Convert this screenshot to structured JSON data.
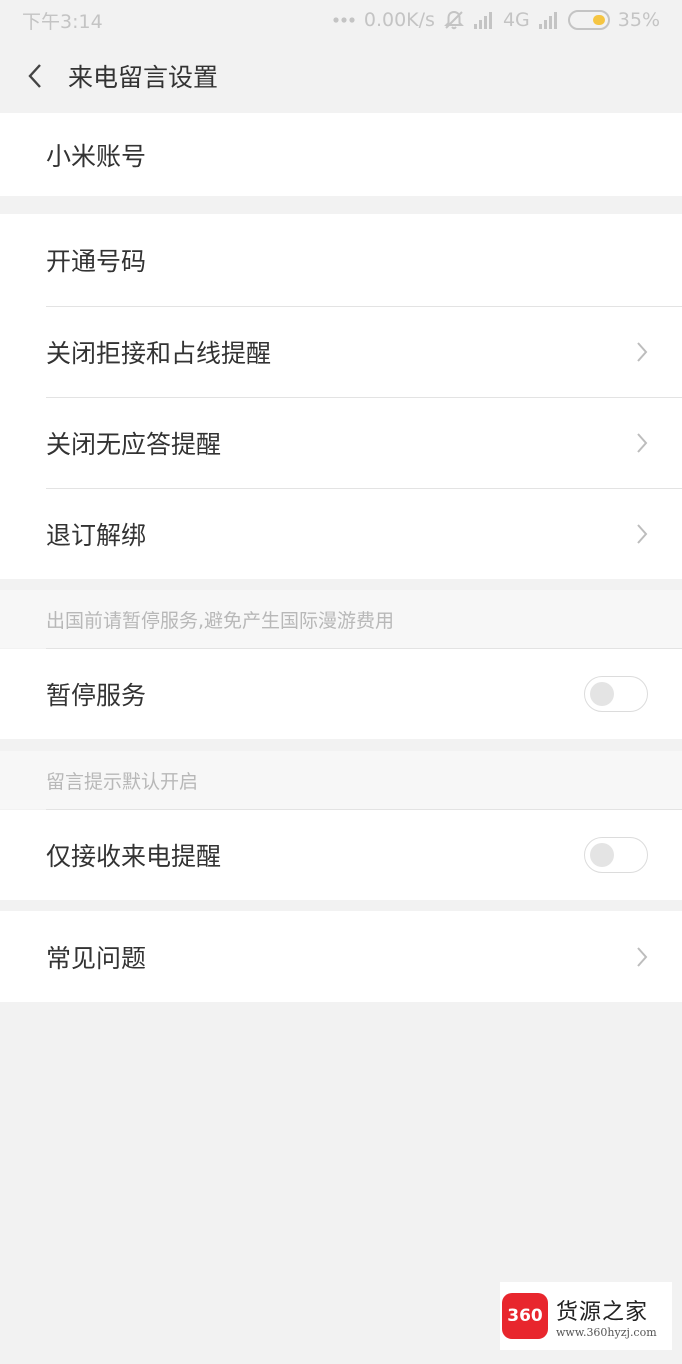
{
  "status_bar": {
    "time": "下午3:14",
    "network_speed": "0.00K/s",
    "network_type": "4G",
    "battery": "35%",
    "icons": [
      "dots-icon",
      "mute-bell-icon",
      "signal-icon",
      "signal-icon",
      "battery-icon"
    ]
  },
  "header": {
    "back_icon": "chevron-left-icon",
    "title": "来电留言设置"
  },
  "group1": {
    "items": [
      {
        "label": "小米账号"
      },
      {
        "label": "开通号码"
      },
      {
        "label": "关闭拒接和占线提醒",
        "icon": "chevron-right-icon"
      },
      {
        "label": "关闭无应答提醒",
        "icon": "chevron-right-icon"
      },
      {
        "label": "退订解绑",
        "icon": "chevron-right-icon"
      }
    ]
  },
  "group2": {
    "header": "出国前请暂停服务,避免产生国际漫游费用",
    "item": {
      "label": "暂停服务",
      "toggle_on": false
    }
  },
  "group3": {
    "header": "留言提示默认开启",
    "item": {
      "label": "仅接收来电提醒",
      "toggle_on": false
    }
  },
  "group4": {
    "item": {
      "label": "常见问题",
      "icon": "chevron-right-icon"
    }
  },
  "watermark": {
    "badge": "360",
    "name": "货源之家",
    "url": "www.360hyzj.com"
  },
  "colors": {
    "background": "#f2f2f2",
    "card": "#ffffff",
    "text": "#333333",
    "hint": "#b8b8b8",
    "battery_fill": "#f5c542",
    "watermark_red": "#e8262d"
  }
}
